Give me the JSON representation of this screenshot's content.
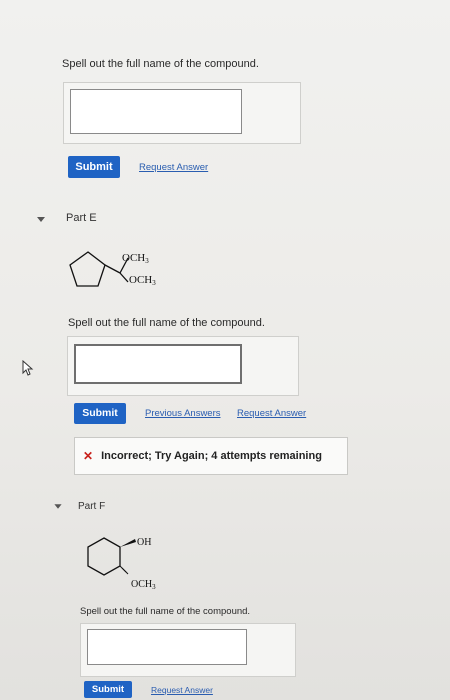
{
  "top": {
    "prompt": "Spell out the full name of the compound.",
    "submit_label": "Submit",
    "request_answer_label": "Request Answer"
  },
  "part_e": {
    "label": "Part E",
    "substituent_top": "OCH",
    "substituent_bottom": "OCH",
    "subscript": "3",
    "prompt": "Spell out the full name of the compound.",
    "submit_label": "Submit",
    "previous_answers_label": "Previous Answers",
    "request_answer_label": "Request Answer",
    "feedback": "Incorrect; Try Again; 4 attempts remaining"
  },
  "part_f": {
    "label": "Part F",
    "substituent_top": "OH",
    "substituent_bottom": "OCH",
    "subscript": "3",
    "prompt": "Spell out the full name of the compound.",
    "submit_label": "Submit",
    "request_answer_label": "Request Answer"
  },
  "colors": {
    "submit_bg": "#1f63c4",
    "link": "#2a5db0",
    "error": "#c8201b"
  },
  "icons": {
    "caret": "caret-down-icon",
    "error": "x-icon",
    "cursor": "mouse-cursor-icon"
  }
}
